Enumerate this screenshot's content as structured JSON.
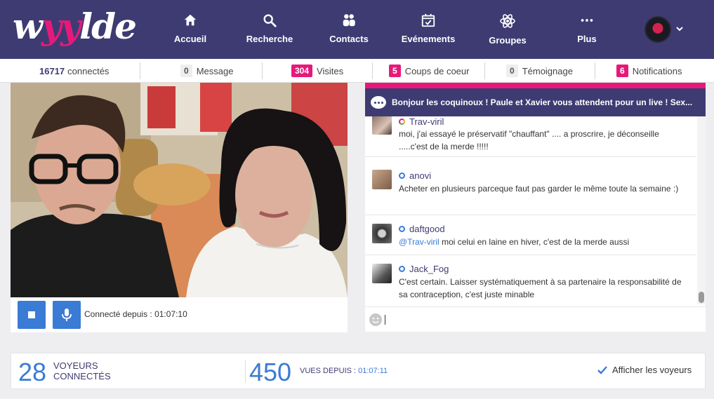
{
  "brand": {
    "logo_part1": "w",
    "logo_part2": "yy",
    "logo_part3": "lde"
  },
  "nav": [
    {
      "label": "Accueil",
      "icon": "home-icon"
    },
    {
      "label": "Recherche",
      "icon": "search-icon"
    },
    {
      "label": "Contacts",
      "icon": "contacts-icon"
    },
    {
      "label": "Evénements",
      "icon": "calendar-icon"
    },
    {
      "label": "Groupes",
      "icon": "atom-icon"
    },
    {
      "label": "Plus",
      "icon": "more-icon"
    }
  ],
  "stats": {
    "connected_count": "16717",
    "connected_label": "connectés",
    "message_count": "0",
    "message_label": "Message",
    "visits_count": "304",
    "visits_label": "Visites",
    "crush_count": "5",
    "crush_label": "Coups de coeur",
    "testimony_count": "0",
    "testimony_label": "Témoignage",
    "notif_count": "6",
    "notif_label": "Notifications"
  },
  "video": {
    "connected_text": "Connecté depuis : 01:07:10"
  },
  "chat": {
    "header": "Bonjour les coquinoux ! Paule et Xavier vous attendent pour un live ! Sex...",
    "messages": [
      {
        "user": "Trav-viril",
        "text": "moi, j'ai essayé le préservatif \"chauffant\" .... a proscrire, je déconseille .....c'est de la merde !!!!!"
      },
      {
        "user": "anovi",
        "text": "Acheter en plusieurs parceque faut pas garder le même toute la semaine :)"
      },
      {
        "user": "daftgood",
        "mention": "@Trav-viril",
        "text": " moi celui en laine en hiver, c'est de la merde aussi"
      },
      {
        "user": "Jack_Fog",
        "text": "C'est certain. Laisser systématiquement à sa partenaire la responsabilité de sa contraception, c'est juste minable"
      }
    ],
    "input_value": ""
  },
  "footer": {
    "voyeurs_count": "28",
    "voyeurs_label_1": "VOYEURS",
    "voyeurs_label_2": "CONNECTÉS",
    "views_count": "450",
    "views_label": "VUES DEPUIS :",
    "views_time": "01:07:11",
    "show_voyeurs_label": "Afficher les voyeurs",
    "show_voyeurs_checked": true
  },
  "colors": {
    "nav_bg": "#3e3b73",
    "accent_pink": "#e6197a",
    "accent_blue": "#3a7bd5"
  }
}
